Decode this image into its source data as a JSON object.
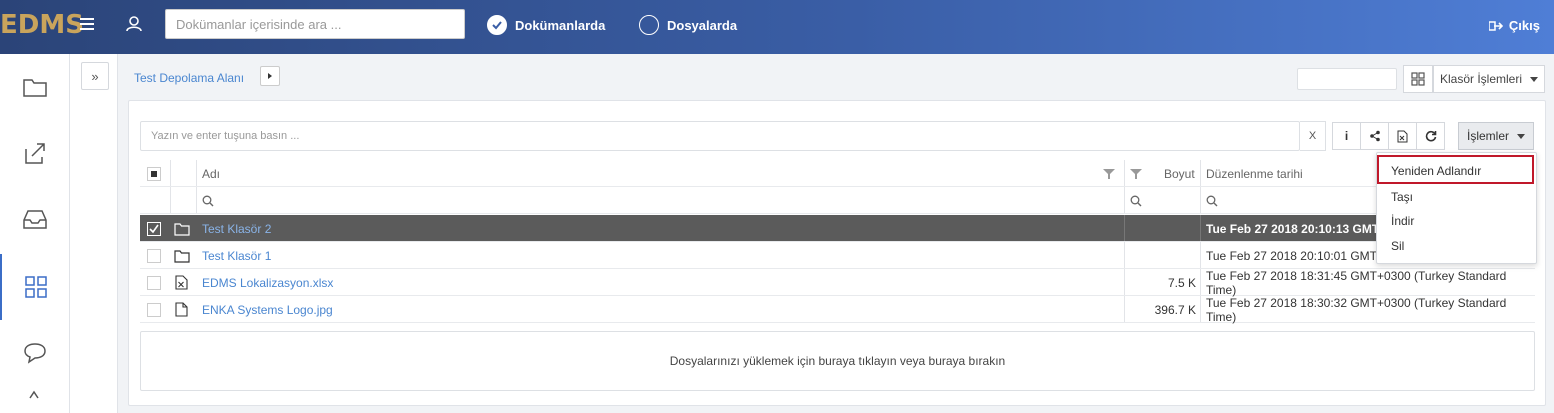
{
  "app": {
    "logo": "EDMS"
  },
  "topbar": {
    "search_placeholder": "Dokümanlar içerisinde ara ...",
    "radio_docs": "Dokümanlarda",
    "radio_files": "Dosyalarda",
    "logout": "Çıkış"
  },
  "breadcrumb": {
    "root": "Test Depolama Alanı"
  },
  "toolbar": {
    "folder_ops": "Klasör İşlemleri",
    "operations": "İşlemler"
  },
  "filter": {
    "placeholder": "Yazın ve enter tuşuna basın ...",
    "clear": "X"
  },
  "table": {
    "headers": {
      "name": "Adı",
      "size": "Boyut",
      "modified": "Düzenlenme tarihi"
    },
    "rows": [
      {
        "name": "Test Klasör 2",
        "size": "",
        "modified": "Tue Feb 27 2018 20:10:13 GMT+",
        "type": "folder",
        "selected": true
      },
      {
        "name": "Test Klasör 1",
        "size": "",
        "modified": "Tue Feb 27 2018 20:10:01 GMT+",
        "type": "folder",
        "selected": false
      },
      {
        "name": "EDMS Lokalizasyon.xlsx",
        "size": "7.5 K",
        "modified": "Tue Feb 27 2018 18:31:45 GMT+0300 (Turkey Standard Time)",
        "type": "excel",
        "selected": false
      },
      {
        "name": "ENKA Systems Logo.jpg",
        "size": "396.7 K",
        "modified": "Tue Feb 27 2018 18:30:32 GMT+0300 (Turkey Standard Time)",
        "type": "file",
        "selected": false
      }
    ]
  },
  "dropzone": {
    "text": "Dosyalarınızı yüklemek için buraya tıklayın veya buraya bırakın"
  },
  "dropdown": {
    "items": [
      "Yeniden Adlandır",
      "Taşı",
      "İndir",
      "Sil"
    ]
  },
  "colors": {
    "accent": "#4a86d0",
    "topbar": "#3a5ea6",
    "highlight": "#c0182a",
    "logo": "#c9a45c"
  }
}
